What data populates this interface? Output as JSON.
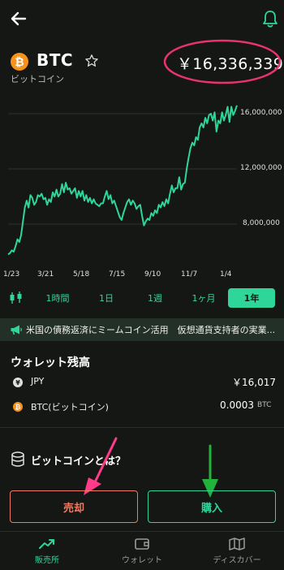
{
  "header": {
    "back_icon": "arrow-left-icon",
    "bell_icon": "bell-icon"
  },
  "coin": {
    "logo_glyph": "₿",
    "symbol": "BTC",
    "name": "ビットコイン",
    "price": "￥16,336,339",
    "logo_color": "#f7931a"
  },
  "chart_data": {
    "type": "line",
    "title": "",
    "xlabel": "",
    "ylabel": "",
    "x_ticks": [
      "1/23",
      "3/21",
      "5/18",
      "7/15",
      "9/10",
      "11/7",
      "1/4"
    ],
    "y_ticks": [
      "16,000,000",
      "12,000,000",
      "8,000,000"
    ],
    "ylim": [
      5000000,
      17000000
    ],
    "grid": true,
    "line_color": "#2fd69a",
    "series": [
      {
        "values": [
          5800000,
          5900000,
          6100000,
          6000000,
          6400000,
          6900000,
          6700000,
          7200000,
          8200000,
          9200000,
          9700000,
          9200000,
          10100000,
          9900000,
          9400000,
          9600000,
          10100000,
          10000000,
          10200000,
          9800000,
          9900000,
          9400000,
          9800000,
          9600000,
          10300000,
          10000000,
          10500000,
          10000000,
          10200000,
          10900000,
          10300000,
          11000000,
          10500000,
          10600000,
          10200000,
          10400000,
          10600000,
          9900000,
          10400000,
          10000000,
          10400000,
          9700000,
          10100000,
          9600000,
          9900000,
          9500000,
          9800000,
          9500000,
          9400000,
          9300000,
          9500000,
          9500000,
          10000000,
          10400000,
          9800000,
          10100000,
          9500000,
          9700000,
          9300000,
          8900000,
          8500000,
          8300000,
          8800000,
          9200000,
          9600000,
          9800000,
          9400000,
          9700000,
          9500000,
          9100000,
          9300000,
          9400000,
          8600000,
          7900000,
          8200000,
          8400000,
          8300000,
          8800000,
          8600000,
          9000000,
          8800000,
          9400000,
          9200000,
          9600000,
          9300000,
          9800000,
          9500000,
          10200000,
          10800000,
          10300000,
          10600000,
          10600000,
          11400000,
          10500000,
          10900000,
          11000000,
          12000000,
          12800000,
          13500000,
          13900000,
          13700000,
          14300000,
          14100000,
          15000000,
          15300000,
          15000000,
          15700000,
          15300000,
          15900000,
          16000000,
          15500000,
          16100000,
          14700000,
          15500000,
          15300000,
          16100000,
          15500000,
          15900000,
          16500000,
          15400000,
          16500000,
          15900000,
          16200000,
          16600000
        ]
      }
    ]
  },
  "tabs": {
    "candle_icon": "candlestick-icon",
    "items": [
      "1時間",
      "1日",
      "1週",
      "1ヶ月",
      "1年"
    ],
    "active_index": 4
  },
  "news": {
    "icon": "megaphone-icon",
    "text": "米国の債務返済にミームコイン活用　仮想通貨支持者の実業..."
  },
  "wallet": {
    "title": "ウォレット残高",
    "rows": [
      {
        "icon_glyph": "¥",
        "label": "JPY",
        "value": "￥16,017",
        "unit": ""
      },
      {
        "icon_glyph": "₿",
        "label": "BTC(ビットコイン)",
        "value": "0.0003",
        "unit": "BTC"
      }
    ]
  },
  "info": {
    "icon": "coins-stack-icon",
    "text": "ビットコインとは？"
  },
  "actions": {
    "sell_label": "売却",
    "buy_label": "購入",
    "sell_color": "#f07a64",
    "buy_color": "#2fd69a"
  },
  "annotations": {
    "circle_color": "#e8336f",
    "sell_arrow_color": "#ff3b8a",
    "buy_arrow_color": "#22b33a"
  },
  "bottom_nav": {
    "items": [
      {
        "label": "販売所",
        "icon": "trend-up-icon",
        "active": true
      },
      {
        "label": "ウォレット",
        "icon": "wallet-icon",
        "active": false
      },
      {
        "label": "ディスカバー",
        "icon": "map-icon",
        "active": false
      }
    ]
  }
}
